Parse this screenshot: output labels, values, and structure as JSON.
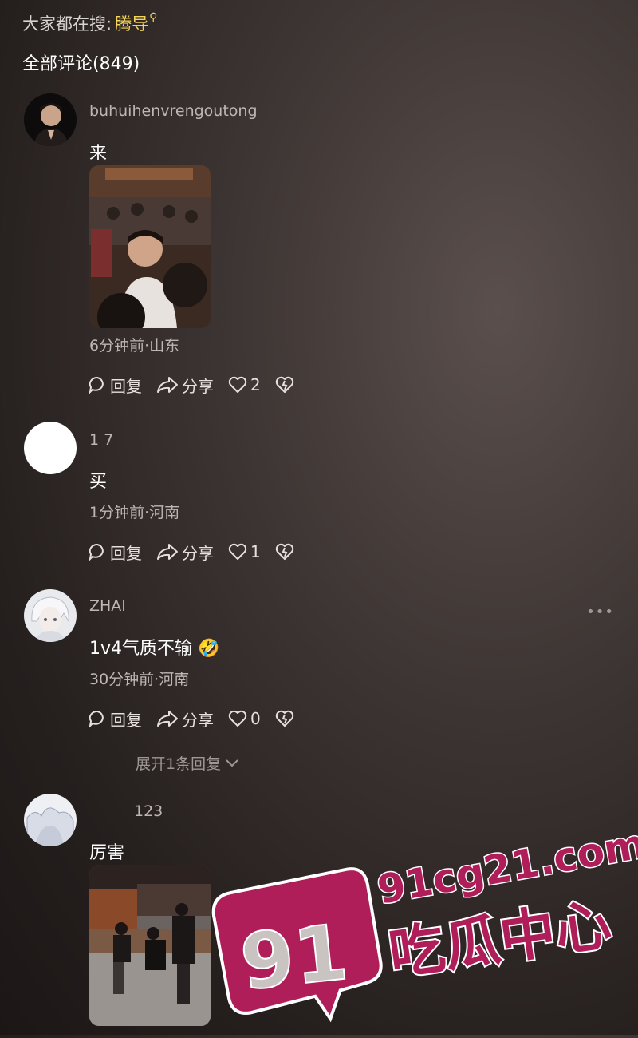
{
  "header": {
    "search_prefix": "大家都在搜:",
    "search_keyword": "腾导",
    "all_comments": "全部评论(849)"
  },
  "comments": [
    {
      "username": "buhuihenvrengoutong",
      "text": "来",
      "meta": "6分钟前·山东",
      "reply": "回复",
      "share": "分享",
      "likes": "2",
      "has_image": true
    },
    {
      "username": "1 7",
      "text": "买",
      "meta": "1分钟前·河南",
      "reply": "回复",
      "share": "分享",
      "likes": "1"
    },
    {
      "username": "ZHAI",
      "text": "1v4气质不输",
      "emoji": "🤣",
      "meta": "30分钟前·河南",
      "reply": "回复",
      "share": "分享",
      "likes": "0",
      "expand_replies": "展开1条回复"
    },
    {
      "username": "123",
      "text": "厉害",
      "has_image": true
    }
  ],
  "watermark": {
    "logo_number": "91",
    "domain": "91cg21.com",
    "name": "吃瓜中心",
    "color": "#b01e5a"
  }
}
